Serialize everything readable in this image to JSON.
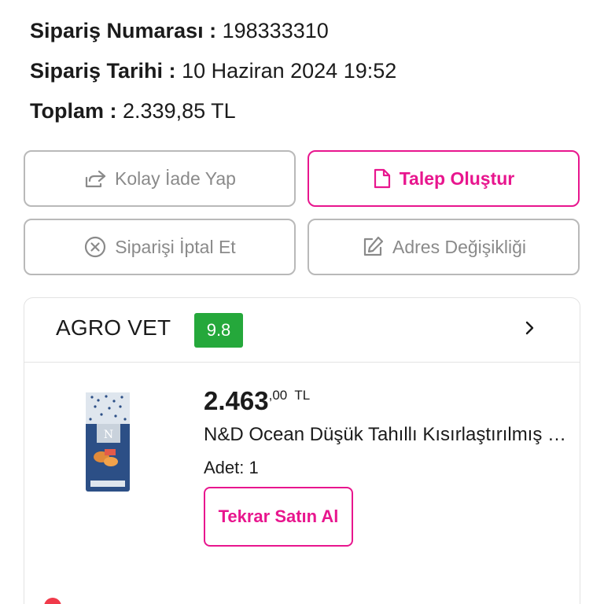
{
  "order": {
    "number_label": "Sipariş Numarası :",
    "number_value": "198333310",
    "date_label": "Sipariş Tarihi :",
    "date_value": "10 Haziran 2024 19:52",
    "total_label": "Toplam :",
    "total_value": "2.339,85 TL"
  },
  "actions": {
    "easy_return": {
      "label": "Kolay İade Yap",
      "icon": "share-arrow-icon"
    },
    "create_request": {
      "label": "Talep Oluştur",
      "icon": "document-icon"
    },
    "cancel_order": {
      "label": "Siparişi İptal Et",
      "icon": "x-circle-icon"
    },
    "address_change": {
      "label": "Adres Değişikliği",
      "icon": "edit-icon"
    }
  },
  "seller": {
    "name": "AGRO VET",
    "rating": "9.8",
    "rating_color": "#25a83b"
  },
  "product": {
    "price_main": "2.463",
    "price_cents": ",00",
    "price_currency": "TL",
    "name": "N&D Ocean Düşük Tahıllı Kısırlaştırılmış Kedi Maması",
    "quantity": "Adet: 1",
    "reorder_label": "Tekrar Satın Al"
  },
  "colors": {
    "accent": "#e8168e",
    "border": "#b9b9b9",
    "muted_text": "#8a8a8a"
  }
}
